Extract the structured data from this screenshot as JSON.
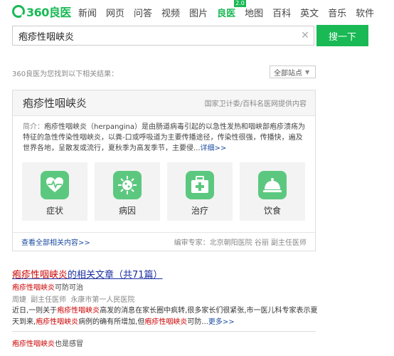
{
  "logo": {
    "text": "360良医"
  },
  "nav": {
    "items": [
      {
        "label": "新闻"
      },
      {
        "label": "网页"
      },
      {
        "label": "问答"
      },
      {
        "label": "视频"
      },
      {
        "label": "图片"
      },
      {
        "label": "良医"
      },
      {
        "label": "地图"
      },
      {
        "label": "百科"
      },
      {
        "label": "英文"
      },
      {
        "label": "音乐"
      },
      {
        "label": "软件"
      }
    ],
    "active_badge": "2.0"
  },
  "search": {
    "value": "疱疹性咽峡炎",
    "button": "搜一下"
  },
  "result_count": "360良医为您找到以下相关结果：",
  "site_filter": {
    "selected": "全部站点"
  },
  "card": {
    "title": "疱疹性咽峡炎",
    "source": "国家卫计委/百科名医网提供内容",
    "intro_label": "简介：",
    "intro_text": "疱疹性咽峡炎（herpangina）是由肠道病毒引起的以急性发热和咽峡部疱疹溃疡为特征的急性传染性咽峡炎，以粪-口或呼吸道为主要传播途径，传染性很强，传播快，遍及世界各地，呈散发或流行，夏秋季为高发季节，主要侵...",
    "detail_link": "详细>>",
    "tiles": [
      {
        "label": "症状",
        "icon": "heart-pulse-icon"
      },
      {
        "label": "病因",
        "icon": "virus-icon"
      },
      {
        "label": "治疗",
        "icon": "medical-kit-icon"
      },
      {
        "label": "饮食",
        "icon": "food-cloche-icon"
      }
    ],
    "more_link": "查看全部相关内容>>",
    "editor": "编审专家：北京朝阳医院 谷丽 副主任医师"
  },
  "results": [
    {
      "title_hl": "疱疹性咽峡炎",
      "title_rest": "的相关文章（共71篇）",
      "sub_hl": "疱疹性咽峡炎",
      "sub_rest": "可防可治",
      "meta": "周婕  副主任医师  永康市第一人民医院",
      "snippet_1": "近日,一则关于",
      "snippet_hl1": "疱疹性咽峡炎",
      "snippet_2": "高发的消息在家长圈中疯转,很多家长们很紧张,市一医儿科专家表示夏天到来,",
      "snippet_hl2": "疱疹性咽峡炎",
      "snippet_3": "病例的确有所增加,但",
      "snippet_hl3": "疱疹性咽峡炎",
      "snippet_4": "可防...",
      "more": "更多>>"
    },
    {
      "title_hl": "疱疹性咽峡炎",
      "title_rest": "也是感冒"
    }
  ],
  "colors": {
    "brand": "#19b955",
    "tile_icon": "#5cc87f",
    "link": "#1a4aa0",
    "highlight": "#cc0000"
  }
}
